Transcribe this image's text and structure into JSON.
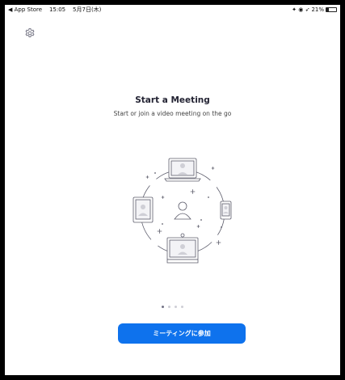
{
  "status_bar": {
    "back_app": "◀ App Store",
    "time": "15:05",
    "date": "5月7日(木)",
    "signal_icons": "✦ ◉ ➶",
    "battery_percent": "21%",
    "battery_level": 0.21
  },
  "settings": {
    "icon": "gear-icon"
  },
  "onboarding": {
    "title": "Start a Meeting",
    "subtitle": "Start or join a video meeting on the go",
    "page_count": 4,
    "active_page": 0
  },
  "join_button": {
    "label": "ミーティングに参加"
  },
  "colors": {
    "accent": "#0E72ED",
    "illustration_stroke": "#5c5c6b",
    "dot_active": "#747487",
    "dot_inactive": "#cfcfd6"
  }
}
